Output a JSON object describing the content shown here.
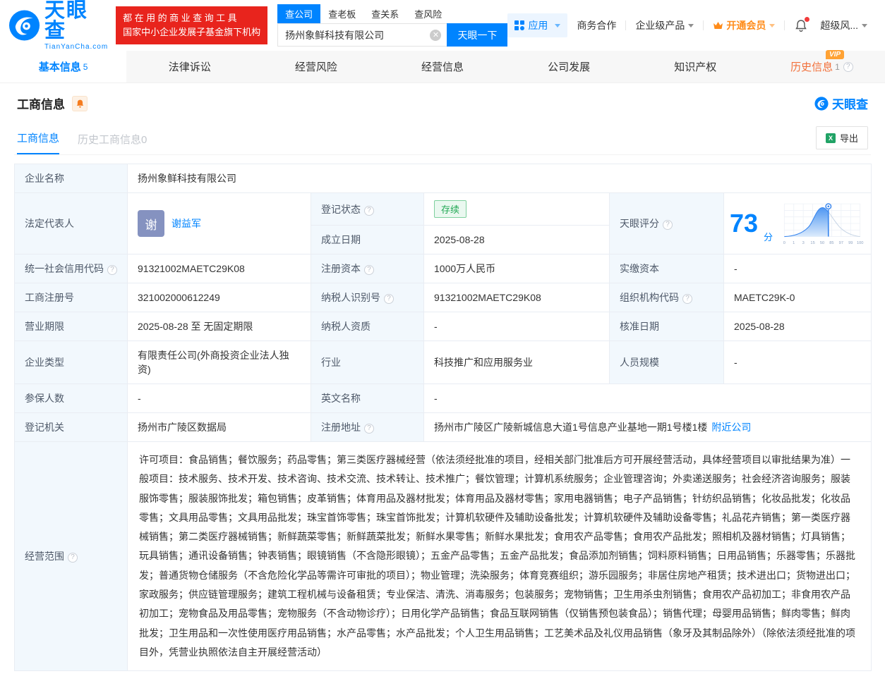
{
  "colors": {
    "accent": "#0084ff",
    "slogan_red": "#e8241d",
    "vip_orange": "#ff8c1a",
    "history_orange": "#f2703a",
    "status_green": "#22a854",
    "score_blue": "#0084ff"
  },
  "header": {
    "logo": {
      "brand": "天眼查",
      "domain": "TianYanCha.com"
    },
    "slogan": {
      "line1": "都在用的商业查询工具",
      "line2": "国家中小企业发展子基金旗下机构"
    },
    "search": {
      "tabs": [
        {
          "label": "查公司"
        },
        {
          "label": "查老板"
        },
        {
          "label": "查关系"
        },
        {
          "label": "查风险"
        }
      ],
      "input_value": "扬州象鲜科技有限公司",
      "button": "天眼一下"
    },
    "nav": {
      "apps": "应用",
      "cooperation": "商务合作",
      "enterprise": "企业级产品",
      "vip": "开通会员",
      "super_risk": "超级风..."
    }
  },
  "tabs": [
    {
      "label": "基本信息",
      "count": "5"
    },
    {
      "label": "法律诉讼"
    },
    {
      "label": "经营风险"
    },
    {
      "label": "经营信息"
    },
    {
      "label": "公司发展"
    },
    {
      "label": "知识产权"
    },
    {
      "label": "历史信息",
      "count": "1",
      "vip": "VIP"
    }
  ],
  "section": {
    "title": "工商信息",
    "watermark": "天眼查",
    "subtabs": [
      {
        "label": "工商信息"
      },
      {
        "label": "历史工商信息0"
      }
    ],
    "export_label": "导出"
  },
  "fields": {
    "company_name": {
      "label": "企业名称",
      "value": "扬州象鲜科技有限公司"
    },
    "legal_rep": {
      "label": "法定代表人",
      "avatar": "谢",
      "name": "谢益军"
    },
    "reg_status": {
      "label": "登记状态",
      "value": "存续"
    },
    "establish_date": {
      "label": "成立日期",
      "value": "2025-08-28"
    },
    "score": {
      "label": "天眼评分",
      "value": "73",
      "unit": "分"
    },
    "credit_code": {
      "label": "统一社会信用代码",
      "value": "91321002MAETC29K08"
    },
    "reg_capital": {
      "label": "注册资本",
      "value": "1000万人民币"
    },
    "paid_capital": {
      "label": "实缴资本",
      "value": "-"
    },
    "reg_no": {
      "label": "工商注册号",
      "value": "321002000612249"
    },
    "taxpayer_no": {
      "label": "纳税人识别号",
      "value": "91321002MAETC29K08"
    },
    "org_code": {
      "label": "组织机构代码",
      "value": "MAETC29K-0"
    },
    "business_term": {
      "label": "营业期限",
      "value": "2025-08-28 至 无固定期限"
    },
    "taxpayer_quality": {
      "label": "纳税人资质",
      "value": "-"
    },
    "approval_date": {
      "label": "核准日期",
      "value": "2025-08-28"
    },
    "company_type": {
      "label": "企业类型",
      "value": "有限责任公司(外商投资企业法人独资)"
    },
    "industry": {
      "label": "行业",
      "value": "科技推广和应用服务业"
    },
    "staff_size": {
      "label": "人员规模",
      "value": "-"
    },
    "insured_num": {
      "label": "参保人数",
      "value": "-"
    },
    "english_name": {
      "label": "英文名称",
      "value": "-"
    },
    "reg_authority": {
      "label": "登记机关",
      "value": "扬州市广陵区数据局"
    },
    "reg_address": {
      "label": "注册地址",
      "value": "扬州市广陵区广陵新城信息大道1号信息产业基地一期1号楼1楼",
      "link": "附近公司"
    },
    "business_scope": {
      "label": "经营范围",
      "value": "许可项目：食品销售；餐饮服务；药品零售；第三类医疗器械经营（依法须经批准的项目，经相关部门批准后方可开展经营活动，具体经营项目以审批结果为准）一般项目：技术服务、技术开发、技术咨询、技术交流、技术转让、技术推广；餐饮管理；计算机系统服务；企业管理咨询；外卖递送服务；社会经济咨询服务；服装服饰零售；服装服饰批发；箱包销售；皮革销售；体育用品及器材批发；体育用品及器材零售；家用电器销售；电子产品销售；针纺织品销售；化妆品批发；化妆品零售；文具用品零售；文具用品批发；珠宝首饰零售；珠宝首饰批发；计算机软硬件及辅助设备批发；计算机软硬件及辅助设备零售；礼品花卉销售；第一类医疗器械销售；第二类医疗器械销售；新鲜蔬菜零售；新鲜蔬菜批发；新鲜水果零售；新鲜水果批发；食用农产品零售；食用农产品批发；照相机及器材销售；灯具销售；玩具销售；通讯设备销售；钟表销售；眼镜销售（不含隐形眼镜）；五金产品零售；五金产品批发；食品添加剂销售；饲料原料销售；日用品销售；乐器零售；乐器批发；普通货物仓储服务（不含危险化学品等需许可审批的项目）；物业管理；洗染服务；体育竞赛组织；游乐园服务；非居住房地产租赁；技术进出口；货物进出口；家政服务；供应链管理服务；建筑工程机械与设备租赁；专业保洁、清洗、消毒服务；包装服务；宠物销售；卫生用杀虫剂销售；食用农产品初加工；非食用农产品初加工；宠物食品及用品零售；宠物服务（不含动物诊疗）；日用化学产品销售；食品互联网销售（仅销售预包装食品）；销售代理；母婴用品销售；鲜肉零售；鲜肉批发；卫生用品和一次性使用医疗用品销售；水产品零售；水产品批发；个人卫生用品销售；工艺美术品及礼仪用品销售（象牙及其制品除外）（除依法须经批准的项目外，凭营业执照依法自主开展经营活动）"
    }
  },
  "score_chart": {
    "type": "area",
    "marker_value": 73,
    "ticks": [
      "0",
      "1",
      "3",
      "15",
      "50",
      "85",
      "97",
      "99",
      "100"
    ]
  }
}
